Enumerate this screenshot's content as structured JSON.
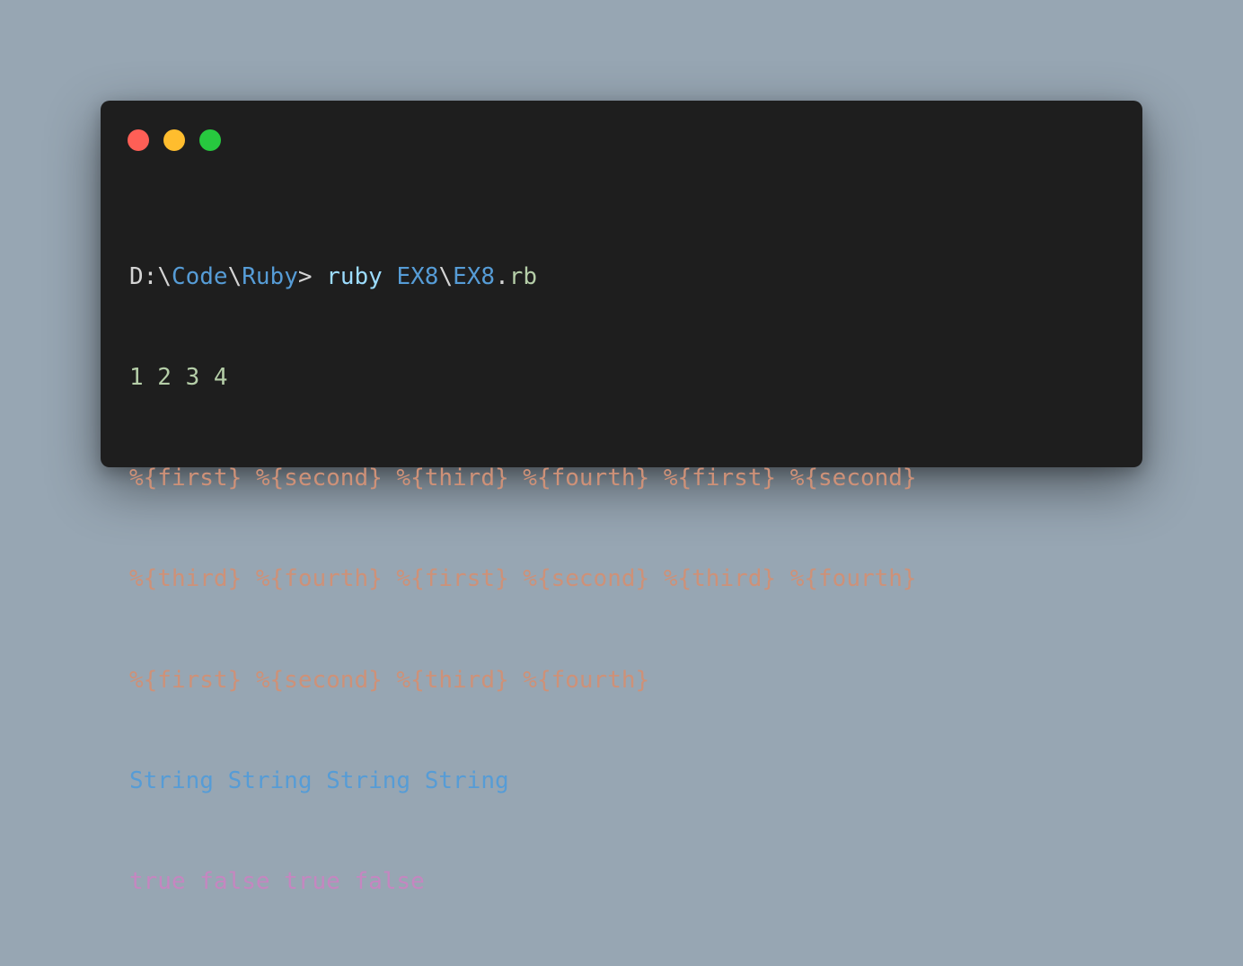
{
  "colors": {
    "background": "#97a6b3",
    "window": "#1e1e1e",
    "close": "#ff5f56",
    "minimize": "#ffbd2e",
    "zoom": "#27c93f",
    "plain_text": "#d4d4d4",
    "command": "#9cdcfe",
    "path": "#569cd6",
    "number": "#b5cea8",
    "string": "#ce9178",
    "boolean": "#c586c0"
  },
  "window_controls": [
    "close-icon",
    "minimize-icon",
    "zoom-icon"
  ],
  "terminal": {
    "prompt": {
      "drive": "D:",
      "sep1": "\\",
      "dir1": "Code",
      "sep2": "\\",
      "dir2": "Ruby",
      "gt": "> ",
      "command": "ruby",
      "space": " ",
      "arg_dir": "EX8",
      "sep3": "\\",
      "arg_file": "EX8",
      "ext_dot": ".",
      "ext": "rb"
    },
    "output": {
      "numbers": "1 2 3 4",
      "format_lines": [
        "%{first} %{second} %{third} %{fourth} %{first} %{second}",
        "%{third} %{fourth} %{first} %{second} %{third} %{fourth}",
        "%{first} %{second} %{third} %{fourth}"
      ],
      "types": "String String String String",
      "booleans": "true false true false"
    }
  }
}
